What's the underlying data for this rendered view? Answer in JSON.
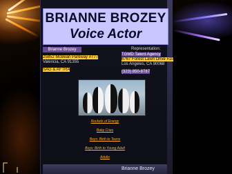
{
  "header": {
    "name": "BRIANNE BROZEY",
    "subtitle": "Voice Actor"
  },
  "contact": {
    "name_bar": "Brianne Brozey",
    "address_line1": "25852 McBean Parkway #777",
    "address_line2": "Valencia, CA 91355",
    "union": "SAG & AFTRA"
  },
  "representation": {
    "label": "Representation:",
    "agency": "TGMD Talent Agency",
    "street": "6767 Forest Lawn Drive #10",
    "city": "Los Angeles, CA 90068",
    "phone": "(323) 850-8787"
  },
  "nav": {
    "items": [
      {
        "label": "Rockets of Energy"
      },
      {
        "label": "Baby Cries"
      },
      {
        "label": "Boys: Birth to Teens"
      },
      {
        "label": "Boys: Birth to Young Adult"
      },
      {
        "label": "Adults"
      }
    ]
  },
  "footer": {
    "name": "Brianne Brozey"
  },
  "colors": {
    "title_bg": "#c9c6ff",
    "nav_link": "#ffb020",
    "highlight_yellow": "#ffcc33",
    "highlight_purple": "#6a4a9a"
  }
}
